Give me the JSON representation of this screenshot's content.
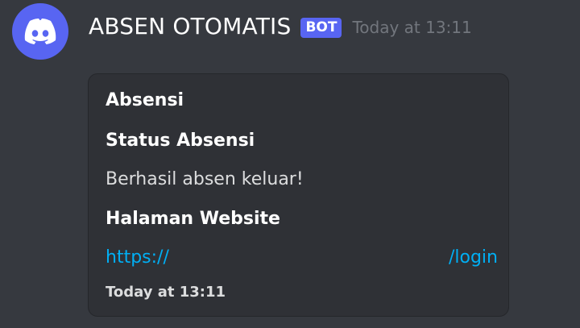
{
  "message": {
    "author": {
      "avatar_icon": "discord-logo-icon",
      "avatar_color": "#5865f2",
      "username": "ABSEN OTOMATIS",
      "bot_tag": "BOT"
    },
    "timestamp": "Today at 13:11",
    "embed": {
      "title": "Absensi",
      "fields": [
        {
          "name": "Status Absensi",
          "value": "Berhasil absen keluar!"
        },
        {
          "name": "Halaman Website",
          "link_start": "https://",
          "link_end": "/login"
        }
      ],
      "footer_timestamp": "Today at 13:11"
    }
  },
  "colors": {
    "background": "#36393f",
    "embed_background": "#2f3136",
    "link": "#00aff4",
    "bot_tag": "#5865f2",
    "muted_text": "#72767d"
  }
}
